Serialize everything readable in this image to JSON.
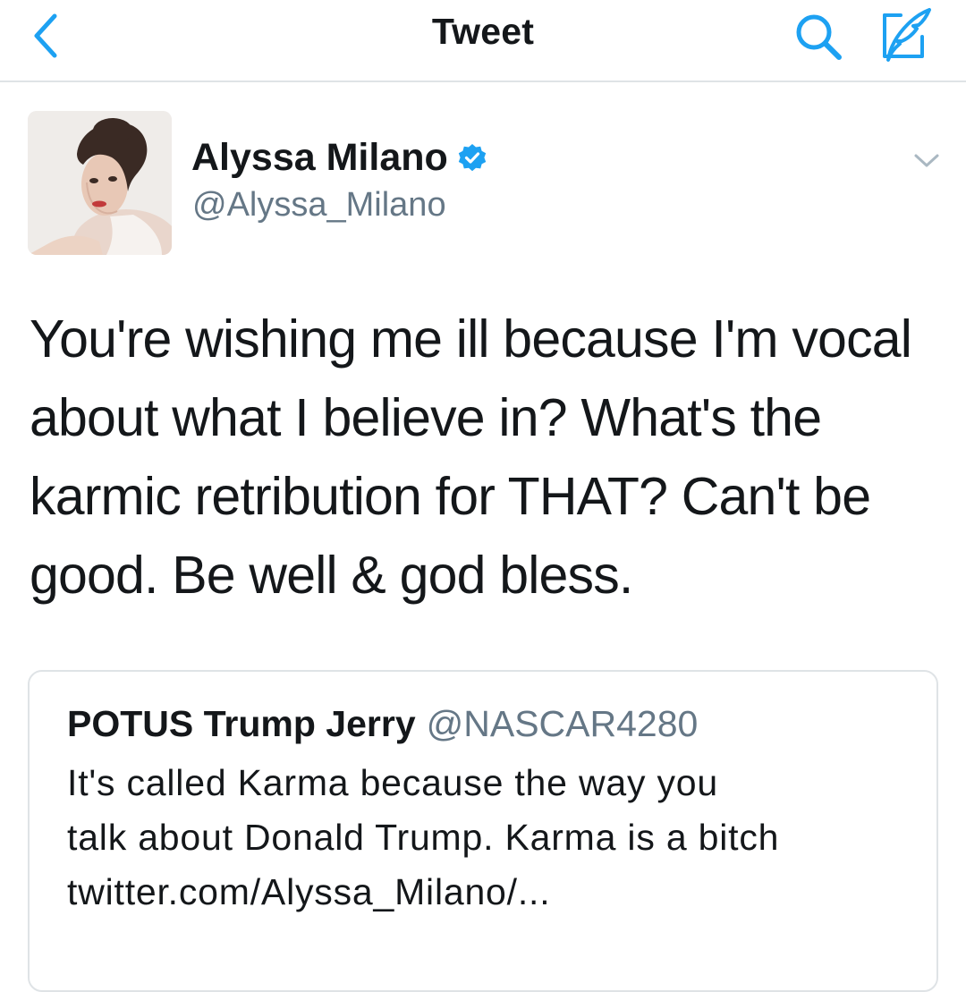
{
  "nav": {
    "title": "Tweet",
    "back_icon": "chevron-left-icon",
    "search_icon": "search-icon",
    "compose_icon": "compose-icon"
  },
  "tweet": {
    "author_name": "Alyssa Milano",
    "author_handle": "@Alyssa_Milano",
    "verified": true,
    "text_lines": [
      "You're wishing me ill because I'm vocal",
      "about what I believe in? What's the",
      "karmic retribution for THAT? Can't be",
      "good. Be well & god bless."
    ]
  },
  "quoted_tweet": {
    "author_name": "POTUS Trump Jerry",
    "author_handle": "@NASCAR4280",
    "text_lines": [
      "It's called Karma because the way you",
      "talk about Donald Trump. Karma is a bitch",
      "twitter.com/Alyssa_Milano/..."
    ]
  },
  "colors": {
    "accent": "#1da1f2",
    "text_primary": "#14171a",
    "text_secondary": "#657786",
    "divider": "#dfe3e6"
  }
}
